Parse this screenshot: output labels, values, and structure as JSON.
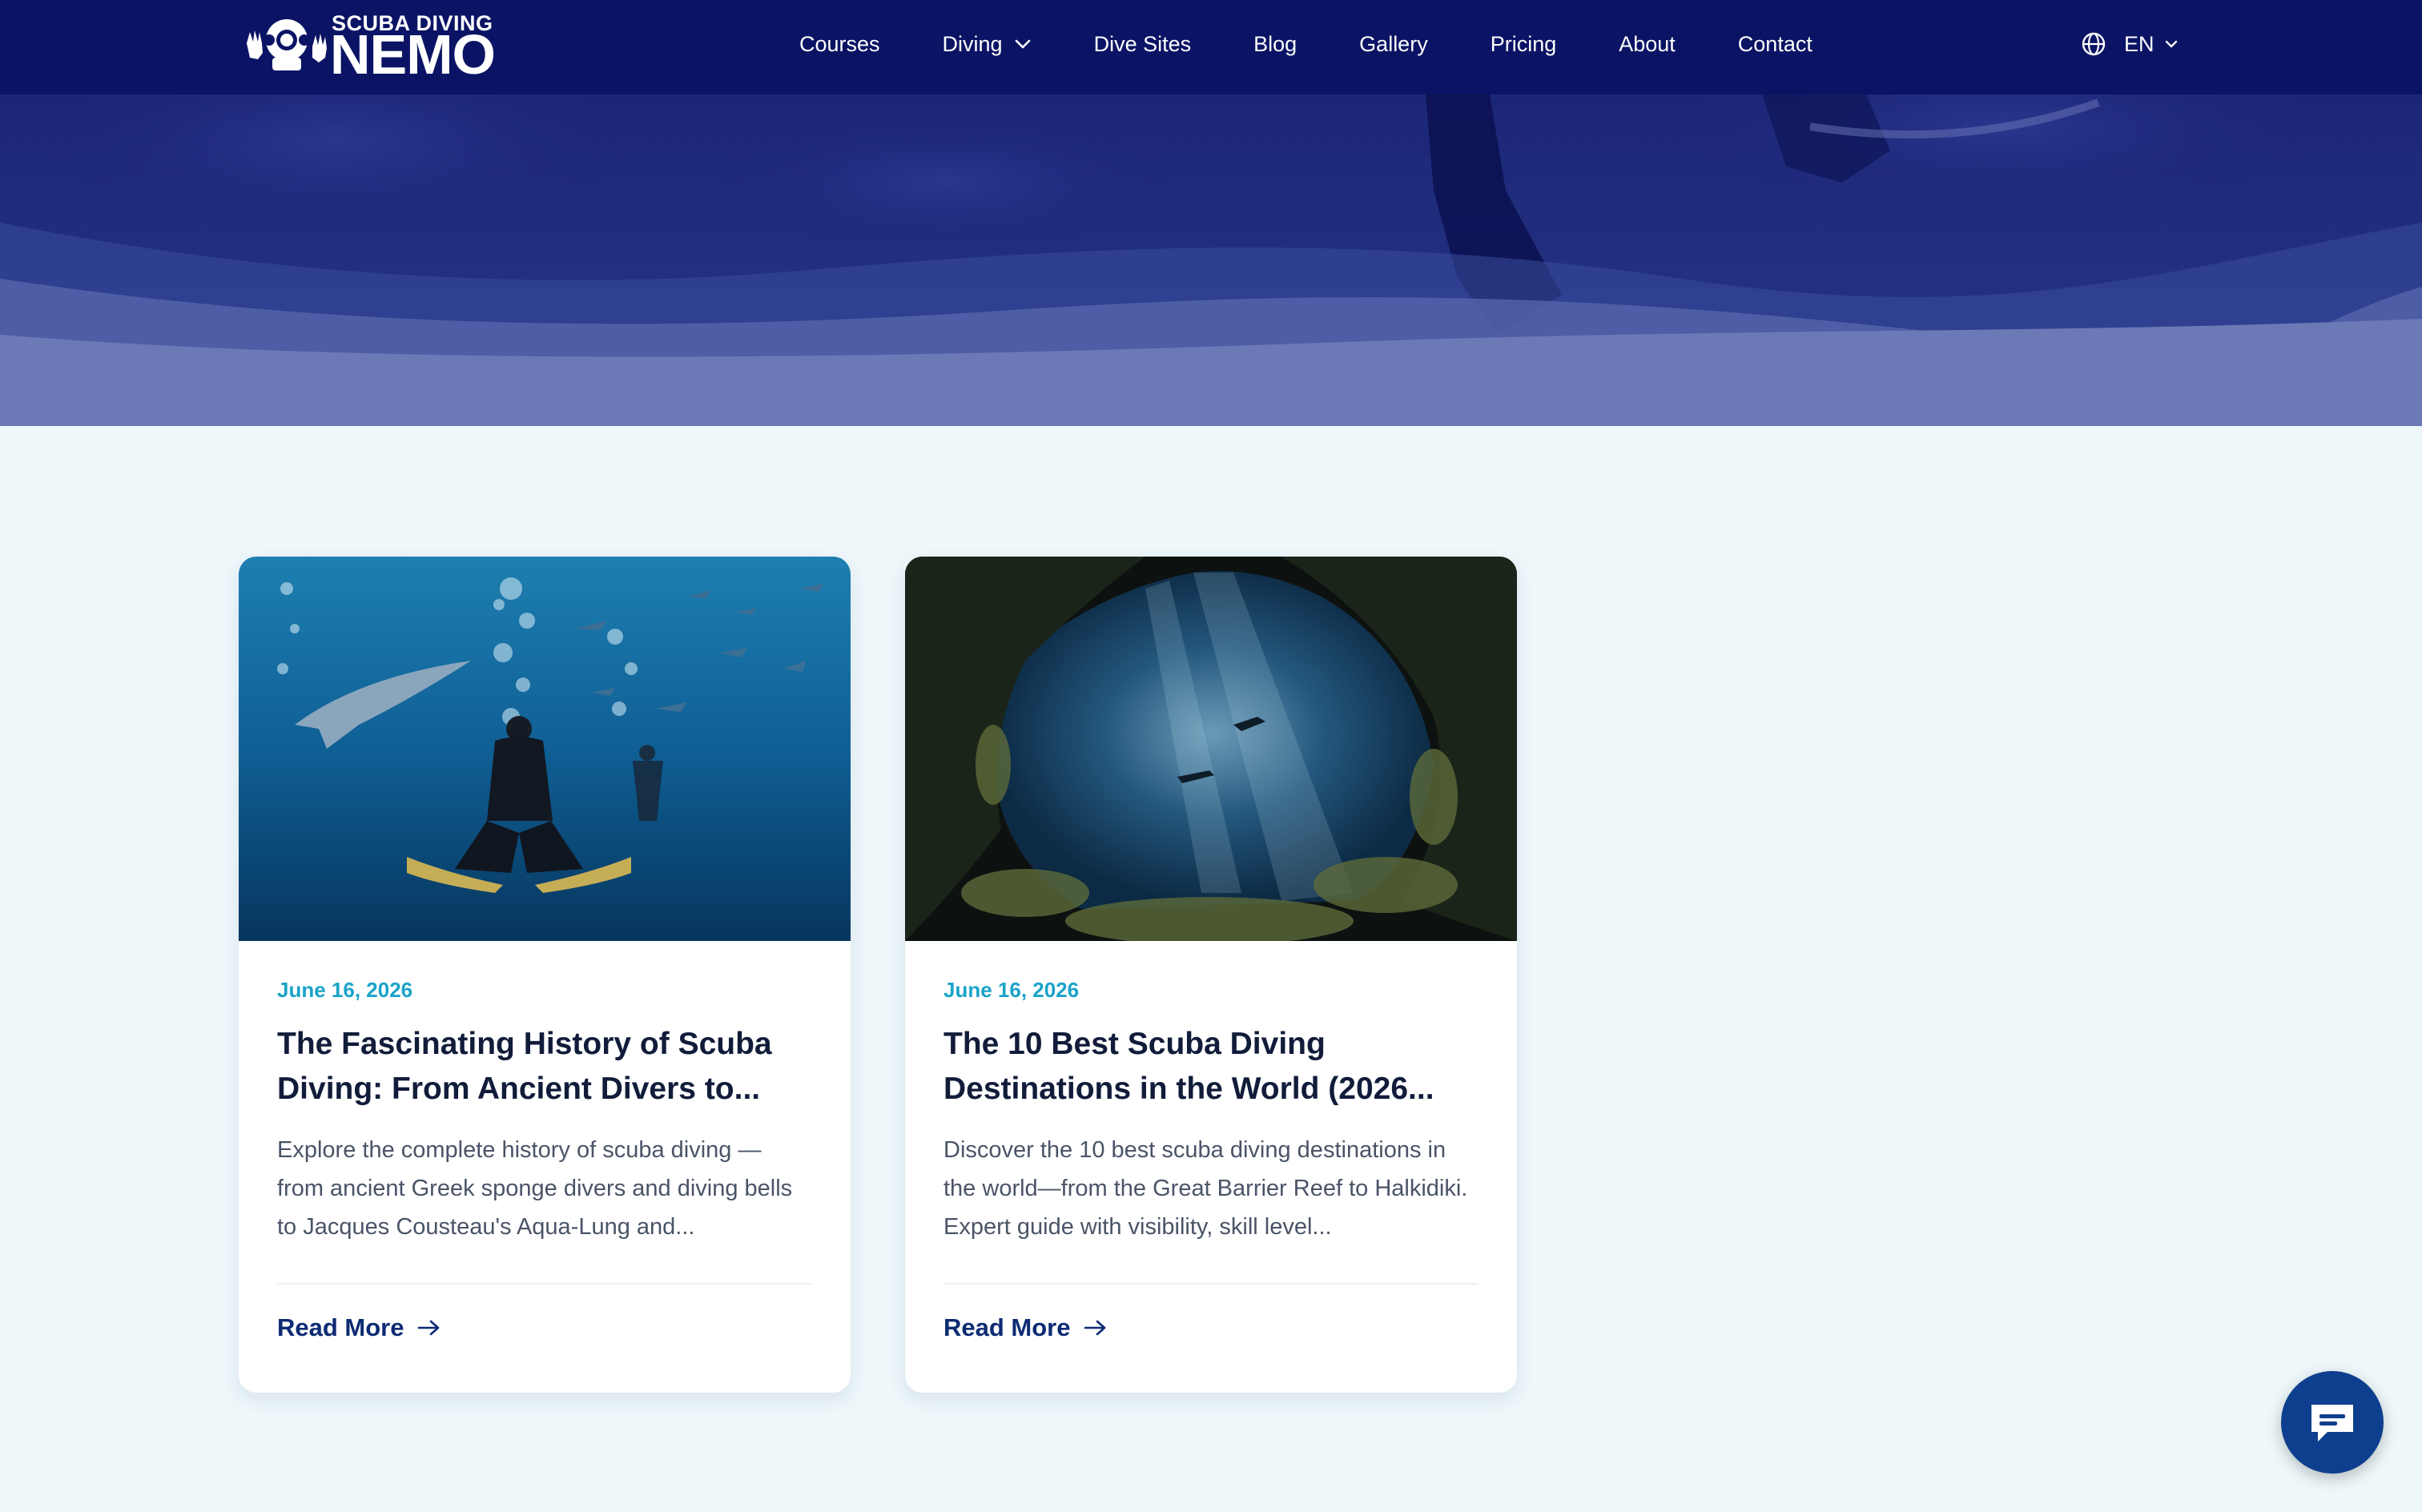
{
  "logo": {
    "top_text": "SCUBA DIVING",
    "main_text": "NEMO"
  },
  "nav": {
    "items": [
      {
        "label": "Courses"
      },
      {
        "label": "Diving",
        "has_dropdown": true
      },
      {
        "label": "Dive Sites"
      },
      {
        "label": "Blog"
      },
      {
        "label": "Gallery"
      },
      {
        "label": "Pricing"
      },
      {
        "label": "About"
      },
      {
        "label": "Contact"
      }
    ],
    "language": "EN"
  },
  "colors": {
    "header_bg": "#0b1464",
    "page_bg": "#eef8fb",
    "date": "#1aa3c8",
    "read_more": "#0d2b73",
    "chat_button": "#0e3f8e"
  },
  "posts": [
    {
      "date": "June 16, 2026",
      "title": "The Fascinating History of Scuba Diving: From Ancient Divers to...",
      "excerpt": "Explore the complete history of scuba diving — from ancient Greek sponge divers and diving bells to Jacques Cousteau's Aqua-Lung and...",
      "read_more": "Read More",
      "image": "diver-with-fish-photo"
    },
    {
      "date": "June 16, 2026",
      "title": "The 10 Best Scuba Diving Destinations in the World (2026...",
      "excerpt": "Discover the 10 best scuba diving destinations in the world—from the Great Barrier Reef to Halkidiki. Expert guide with visibility, skill level...",
      "read_more": "Read More",
      "image": "underwater-cave-photo"
    }
  ],
  "icons": {
    "nav_dropdown": "chevron-down-icon",
    "language": "globe-icon",
    "read_more": "arrow-right-icon",
    "chat": "chat-bubble-icon"
  }
}
